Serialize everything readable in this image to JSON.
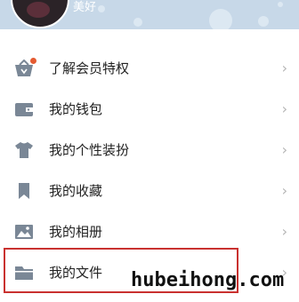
{
  "profile": {
    "name": "美好"
  },
  "menu": {
    "items": [
      {
        "label": "了解会员特权",
        "icon": "vip-basket-icon",
        "badge": true
      },
      {
        "label": "我的钱包",
        "icon": "wallet-icon",
        "badge": false
      },
      {
        "label": "我的个性装扮",
        "icon": "tshirt-icon",
        "badge": false
      },
      {
        "label": "我的收藏",
        "icon": "bookmark-icon",
        "badge": false
      },
      {
        "label": "我的相册",
        "icon": "photo-album-icon",
        "badge": false
      },
      {
        "label": "我的文件",
        "icon": "folder-icon",
        "badge": false
      }
    ],
    "chevron": "›"
  },
  "watermark": "hubeihong.com",
  "colors": {
    "icon": "#7a8796",
    "badge": "#e45b32",
    "highlight": "#c9312f",
    "header": "#c7d8e8"
  }
}
